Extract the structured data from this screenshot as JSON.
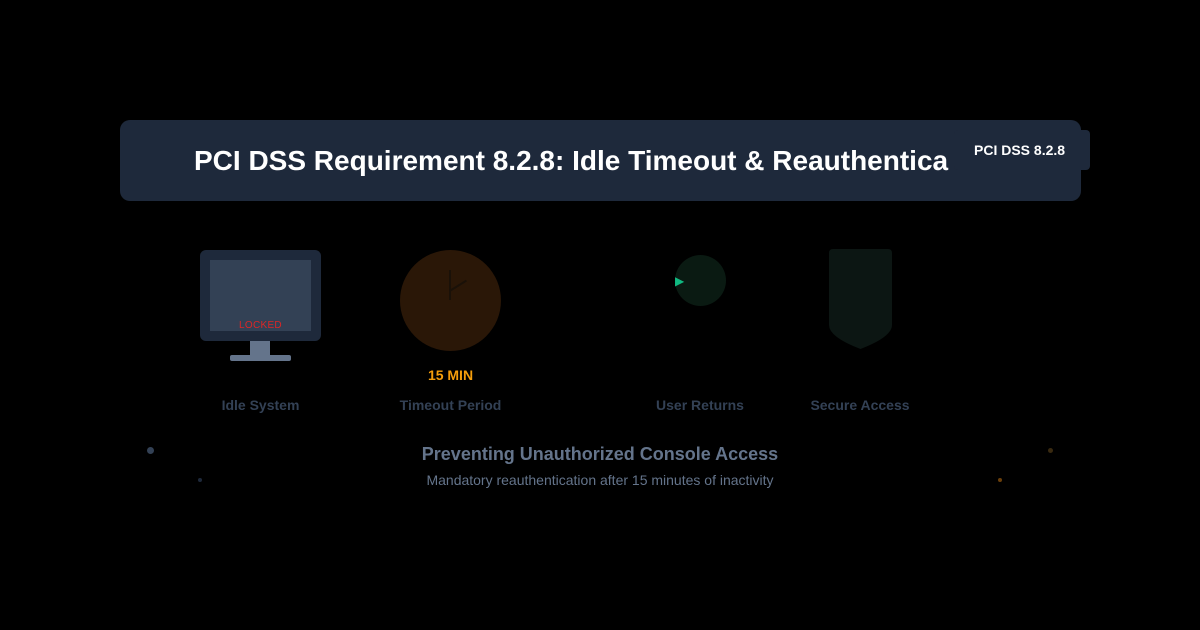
{
  "banner": {
    "title": "PCI DSS Requirement 8.2.8: Idle Timeout & Reauthentica",
    "badge": "PCI DSS 8.2.8"
  },
  "stages": [
    {
      "label": "Idle System",
      "screen_text": "LOCKED",
      "icon": "monitor-icon"
    },
    {
      "label": "Timeout Period",
      "value_text": "15 MIN",
      "icon": "clock-icon"
    },
    {
      "label": "User Returns",
      "icon": "play-icon"
    },
    {
      "label": "Secure Access",
      "icon": "shield-icon"
    }
  ],
  "footer": {
    "heading": "Preventing Unauthorized Console Access",
    "subheading": "Mandatory reauthentication after 15 minutes of inactivity"
  },
  "colors": {
    "background": "#000000",
    "banner": "#1e293b",
    "locked": "#dc2626",
    "timeout": "#f59e0b",
    "returns": "#10b981",
    "muted_text": "#64748b",
    "dim_label": "#334155"
  }
}
